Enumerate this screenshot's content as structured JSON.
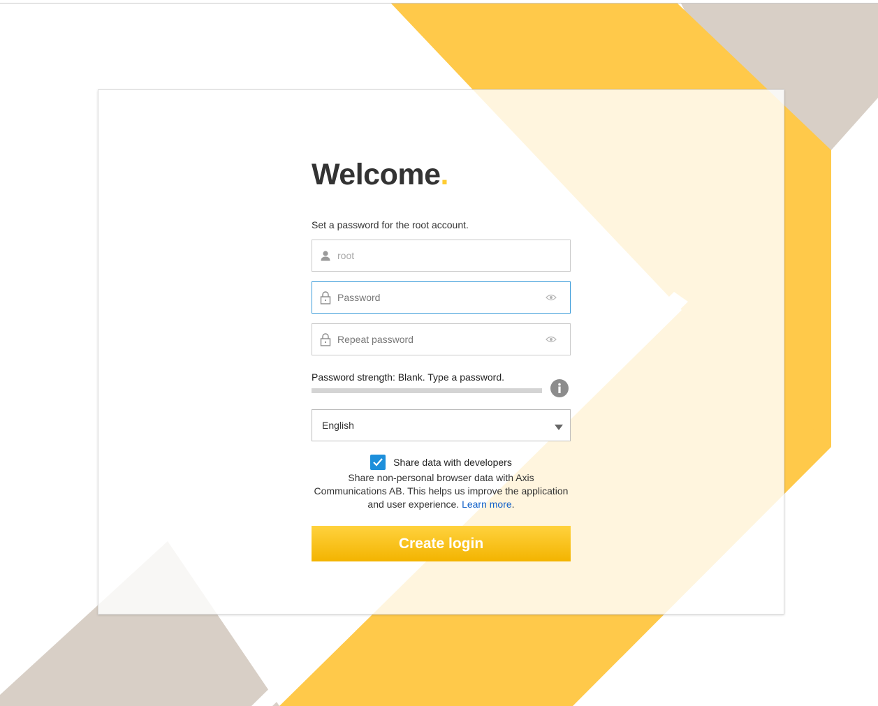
{
  "welcome": {
    "title": "Welcome",
    "title_dot": ".",
    "subtitle": "Set a password for the root account."
  },
  "fields": {
    "username_placeholder": "root",
    "password_placeholder": "Password",
    "repeat_password_placeholder": "Repeat password"
  },
  "strength": {
    "label": "Password strength: Blank. Type a password.",
    "level": 0
  },
  "language": {
    "selected": "English"
  },
  "share": {
    "checked": true,
    "label": "Share data with developers",
    "description": "Share non-personal browser data with Axis Communications AB. This helps us improve the application and user experience.",
    "learn_more": "Learn more",
    "learn_more_suffix": "."
  },
  "submit_label": "Create login",
  "colors": {
    "accent_yellow": "#ffcc33",
    "button_top": "#ffd23e",
    "button_bottom": "#f3b400",
    "checkbox_blue": "#1d8fdb",
    "focus_border": "#3a9bd9",
    "link": "#1060c8",
    "taupe": "#d8cfc6"
  },
  "icons": {
    "username": "user-icon",
    "password": "lock-icon",
    "visibility": "eye-icon",
    "info": "info-icon",
    "dropdown": "caret-down-icon",
    "checkbox": "checkmark-icon"
  }
}
